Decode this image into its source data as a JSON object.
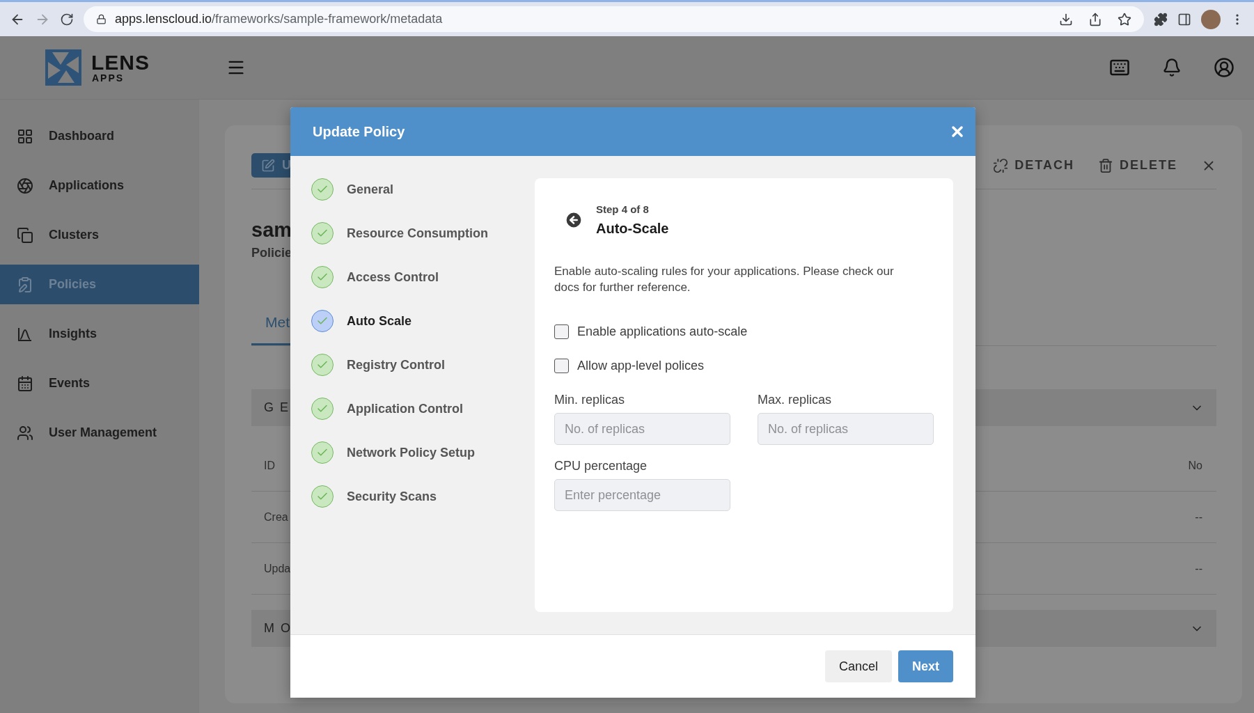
{
  "browser": {
    "url_host": "apps.lenscloud.io",
    "url_path": "/frameworks/sample-framework/metadata"
  },
  "header": {
    "logo_word": "LENS",
    "logo_sub": "APPS"
  },
  "sidebar": {
    "items": [
      {
        "label": "Dashboard",
        "selected": false
      },
      {
        "label": "Applications",
        "selected": false
      },
      {
        "label": "Clusters",
        "selected": false
      },
      {
        "label": "Policies",
        "selected": true
      },
      {
        "label": "Insights",
        "selected": false
      },
      {
        "label": "Events",
        "selected": false
      },
      {
        "label": "User Management",
        "selected": false
      }
    ]
  },
  "page": {
    "update_button": "U",
    "actions": [
      {
        "label": "DETACH"
      },
      {
        "label": "DELETE"
      }
    ],
    "title": "sam",
    "subtitle": "Policie",
    "tab": "Met",
    "rows": [
      {
        "kind": "section",
        "label": "G E"
      },
      {
        "kind": "field",
        "label": "ID",
        "value": "No"
      },
      {
        "kind": "field",
        "label": "Crea",
        "value": "--"
      },
      {
        "kind": "field",
        "label": "Upda",
        "value": "--"
      },
      {
        "kind": "section",
        "label": "M O"
      }
    ]
  },
  "dialog": {
    "title": "Update Policy",
    "steps": [
      {
        "label": "General",
        "selected": false
      },
      {
        "label": "Resource Consumption",
        "selected": false
      },
      {
        "label": "Access Control",
        "selected": false
      },
      {
        "label": "Auto Scale",
        "selected": true
      },
      {
        "label": "Registry Control",
        "selected": false
      },
      {
        "label": "Application Control",
        "selected": false
      },
      {
        "label": "Network Policy Setup",
        "selected": false
      },
      {
        "label": "Security Scans",
        "selected": false
      }
    ],
    "step_counter": "Step 4 of 8",
    "step_title": "Auto-Scale",
    "description": "Enable auto-scaling rules for your applications. Please check our docs for further reference.",
    "checkboxes": [
      {
        "label": "Enable applications auto-scale",
        "checked": false
      },
      {
        "label": "Allow app-level polices",
        "checked": false
      }
    ],
    "fields": [
      {
        "label": "Min. replicas",
        "placeholder": "No. of replicas",
        "disabled": true
      },
      {
        "label": "Max. replicas",
        "placeholder": "No. of replicas",
        "disabled": true
      },
      {
        "label": "CPU percentage",
        "placeholder": "Enter percentage",
        "disabled": true
      }
    ],
    "buttons": [
      {
        "label": "Cancel",
        "kind": "secondary"
      },
      {
        "label": "Next",
        "kind": "primary"
      }
    ]
  }
}
